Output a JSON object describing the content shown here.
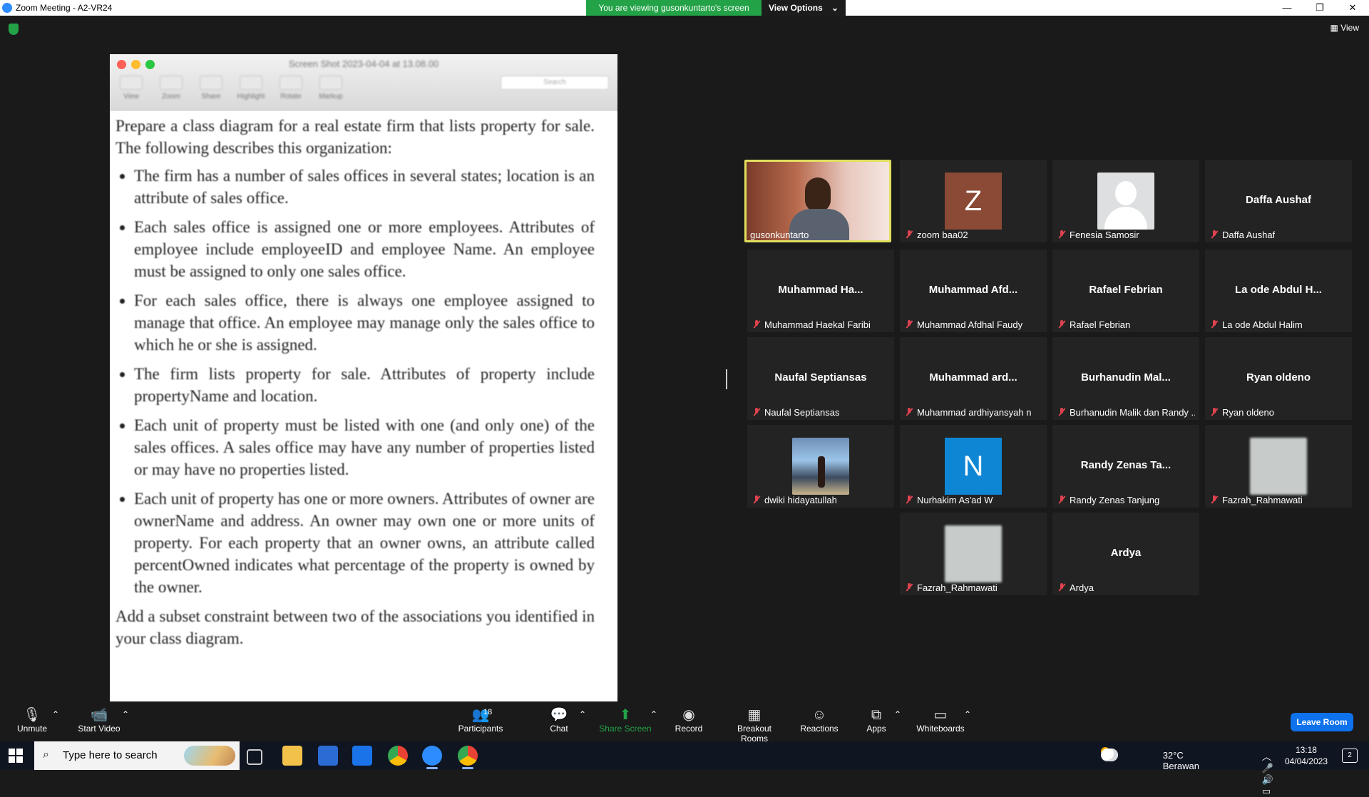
{
  "window": {
    "title": "Zoom Meeting - A2-VR24",
    "controls": [
      "—",
      "❐",
      "✕"
    ]
  },
  "banner": {
    "viewing_text": "You are viewing gusonkuntarto's screen",
    "view_options_label": "View Options",
    "caret": "⌄"
  },
  "meeting": {
    "view_label": "View",
    "view_icon": "▦"
  },
  "shared_screen": {
    "viewer_title": "Screen Shot 2023-04-04 at 13.08.00",
    "toolbar_items": [
      "View",
      "Zoom",
      "Share",
      "Highlight",
      "Rotate",
      "Markup"
    ],
    "search_placeholder": "Search",
    "intro": "Prepare a class diagram for a real estate firm that lists property for sale. The following describes this organization:",
    "bullets": [
      "The firm has a number of sales offices in several states; location is an attribute of sales office.",
      "Each sales office is assigned one or more employees. Attributes of employee include employeeID and employee Name. An employee must be assigned to only one sales office.",
      "For each sales office, there is always one employee assigned to manage that office. An employee may manage only the sales office to which he or she is assigned.",
      "The firm lists property for sale. Attributes of property include propertyName and location.",
      "Each unit of property must be listed with one (and only one) of the sales offices. A sales office may have any number of properties listed or may have no properties listed.",
      "Each unit of property has one or more owners. Attributes of owner are ownerName and address. An owner may own one or more units of property. For each property that an owner owns, an attribute called percentOwned indicates what percentage of the property is owned by the owner."
    ],
    "closing": "Add a subset constraint between two of the associations you identified in your class diagram."
  },
  "participants": {
    "p0": {
      "label": "gusonkuntarto"
    },
    "p1": {
      "letter": "Z",
      "label": "zoom baa02",
      "color": "#8b4a36"
    },
    "p2": {
      "label": "Fenesia Samosir"
    },
    "p3": {
      "display": "Daffa Aushaf",
      "label": "Daffa Aushaf"
    },
    "p4": {
      "display": "Muhammad  Ha...",
      "label": "Muhammad Haekal Faribi"
    },
    "p5": {
      "display": "Muhammad  Afd...",
      "label": "Muhammad Afdhal Faudy"
    },
    "p6": {
      "display": "Rafael Febrian",
      "label": "Rafael Febrian"
    },
    "p7": {
      "display": "La ode Abdul H...",
      "label": "La ode Abdul Halim"
    },
    "p8": {
      "display": "Naufal Septiansas",
      "label": "Naufal Septiansas"
    },
    "p9": {
      "display": "Muhammad  ard...",
      "label": "Muhammad ardhiyansyah n"
    },
    "p10": {
      "display": "Burhanudin  Mal...",
      "label": "Burhanudin Malik dan Randy ..."
    },
    "p11": {
      "display": "Ryan oldeno",
      "label": "Ryan oldeno"
    },
    "p12": {
      "label": "dwiki hidayatullah"
    },
    "p13": {
      "letter": "N",
      "label": "Nurhakim As'ad W",
      "color": "#0e86d4"
    },
    "p14": {
      "display": "Randy Zenas Ta...",
      "label": "Randy Zenas Tanjung"
    },
    "p15": {
      "label": "Fazrah_Rahmawati"
    },
    "p16": {
      "label": "Fazrah_Rahmawati"
    },
    "p17": {
      "display": "Ardya",
      "label": "Ardya"
    }
  },
  "controls": {
    "unmute": "Unmute",
    "start_video": "Start Video",
    "participants": "Participants",
    "participants_count": "18",
    "chat": "Chat",
    "share_screen": "Share Screen",
    "record": "Record",
    "breakout_rooms": "Breakout Rooms",
    "reactions": "Reactions",
    "apps": "Apps",
    "whiteboards": "Whiteboards",
    "leave": "Leave Room",
    "caret": "⌃"
  },
  "taskbar": {
    "search_placeholder": "Type here to search",
    "weather": "32°C  Berawan",
    "time": "13:18",
    "date": "04/04/2023",
    "notification_count": "2",
    "tray_icons": "︿ 🎤 🔊 ▭"
  }
}
